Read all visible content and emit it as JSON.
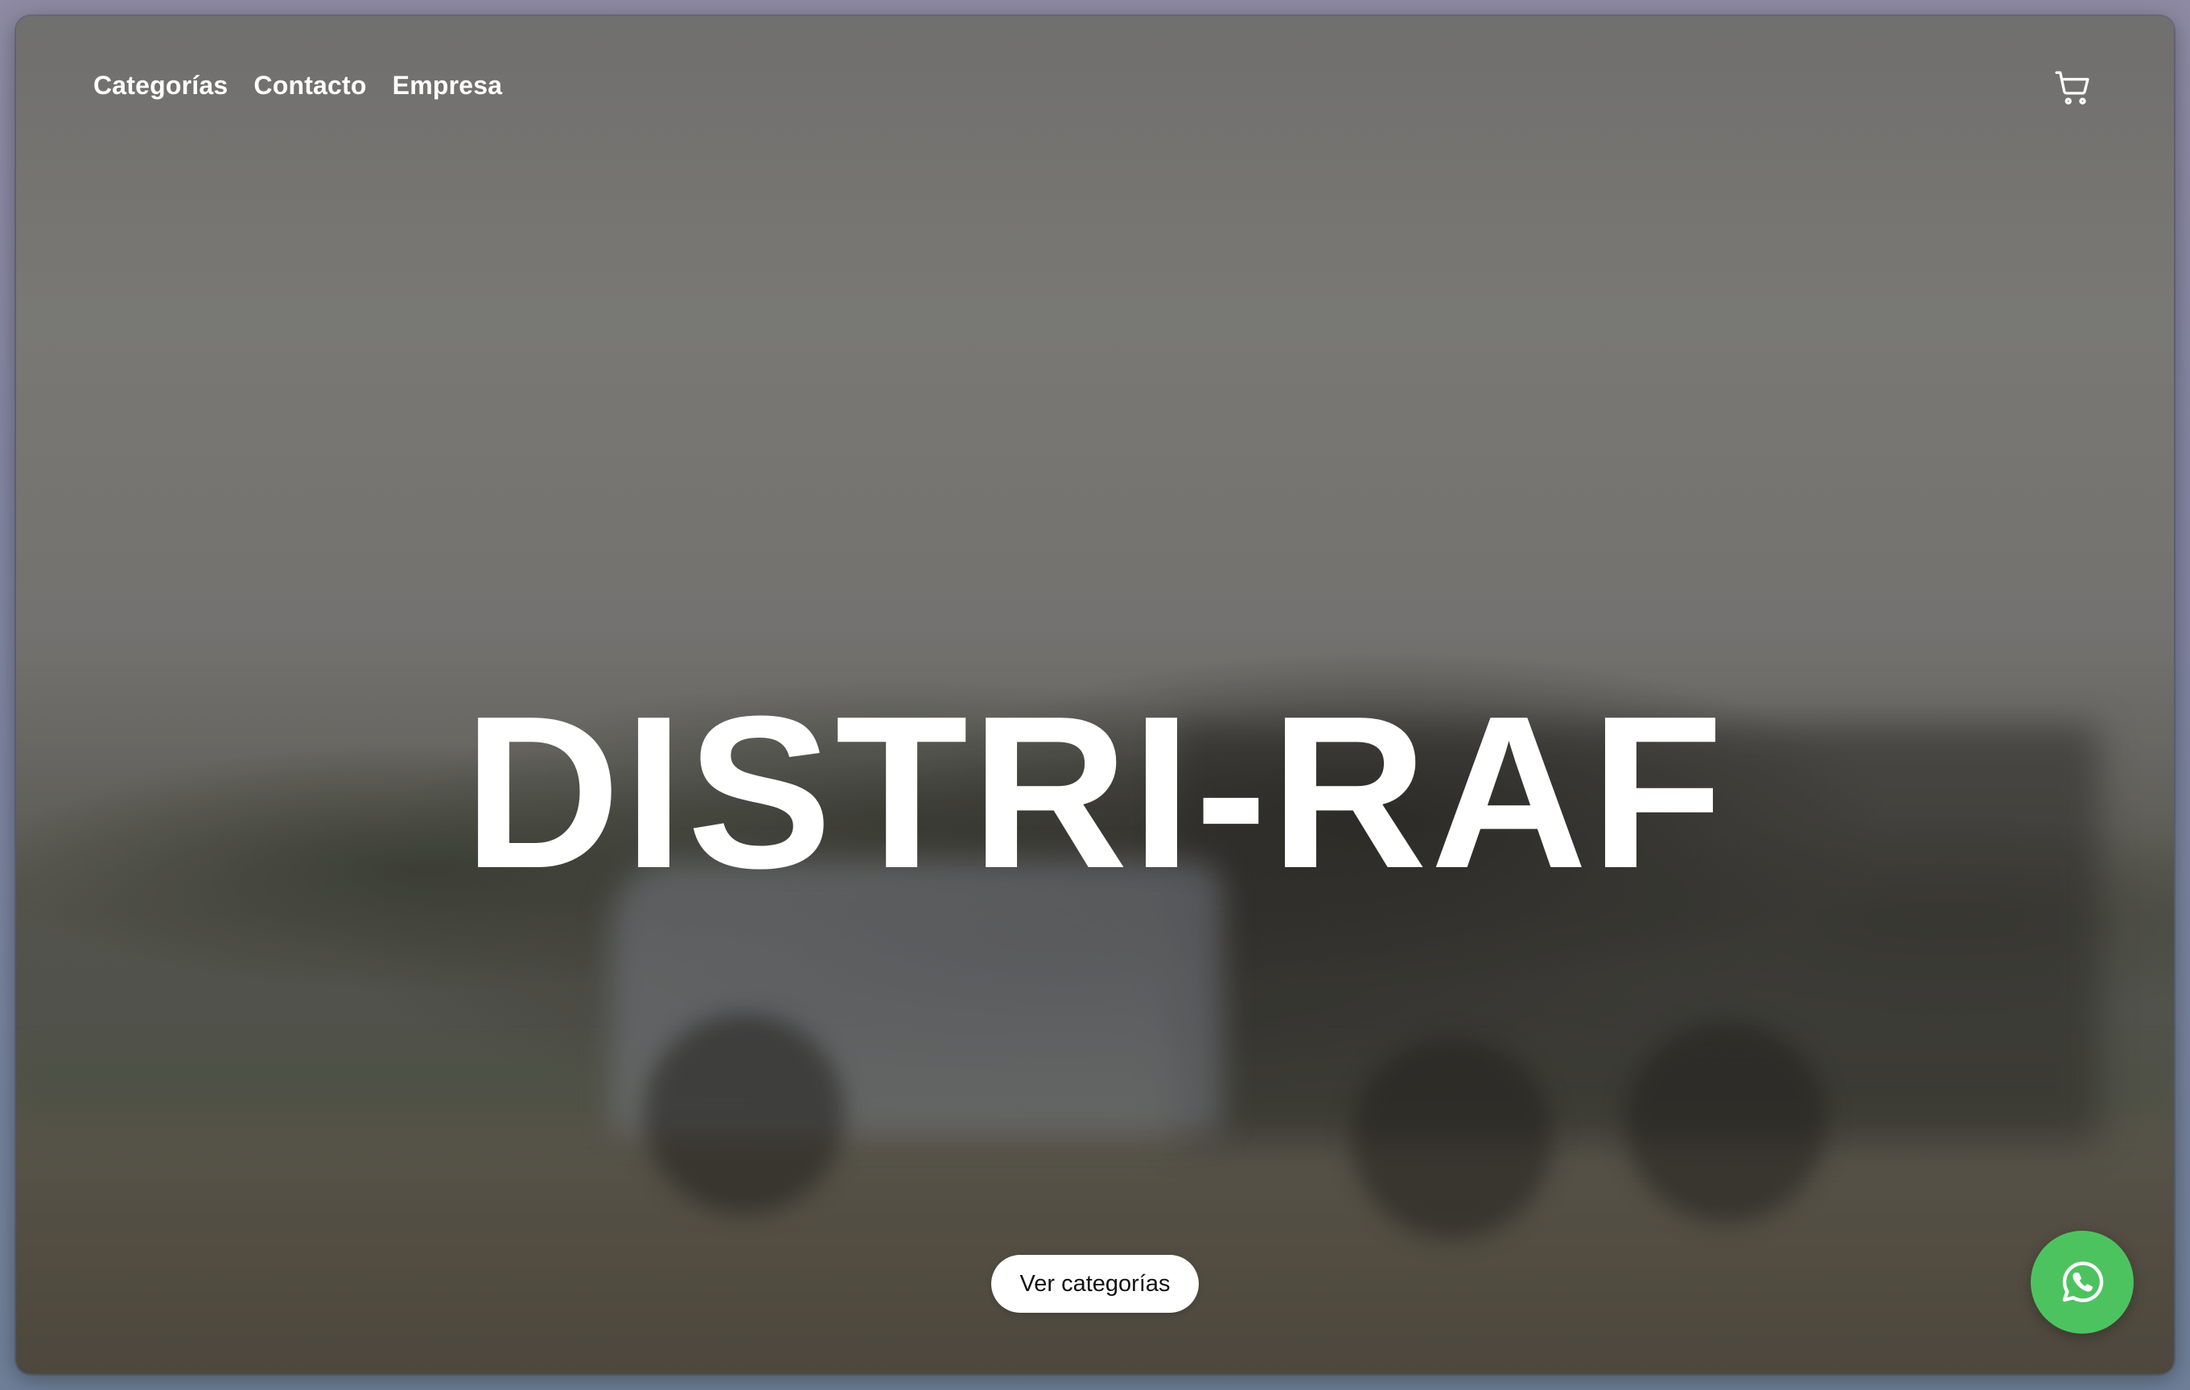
{
  "nav": {
    "items": [
      {
        "label": "Categorías"
      },
      {
        "label": "Contacto"
      },
      {
        "label": "Empresa"
      }
    ],
    "cart_icon": "shopping-cart-icon"
  },
  "hero": {
    "title": "DISTRI-RAF",
    "cta_label": "Ver categorías"
  },
  "floating": {
    "whatsapp_icon": "whatsapp-icon",
    "whatsapp_color": "#4dc35f"
  }
}
